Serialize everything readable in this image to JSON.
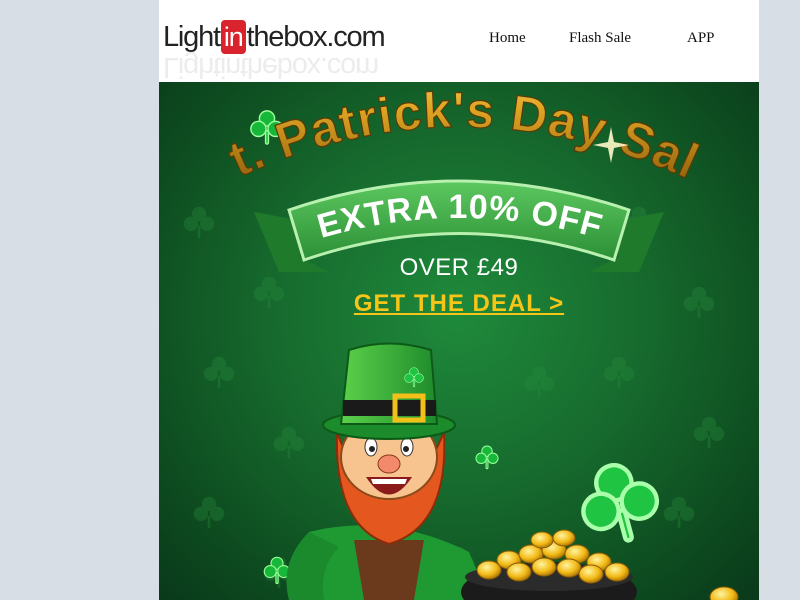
{
  "header": {
    "logo": {
      "part1": "Light",
      "part2": "in",
      "part3": "thebox",
      "part4": ".com"
    },
    "nav": [
      {
        "label": "Home"
      },
      {
        "label": "Flash Sale"
      },
      {
        "label": "APP"
      }
    ]
  },
  "banner": {
    "headline": "St. Patrick's Day Sale",
    "ribbon_text": "EXTRA 10% OFF",
    "threshold": "OVER £49",
    "cta_label": "GET THE DEAL >",
    "colors": {
      "background": "#16692d",
      "headline_gold": "#d9a21b",
      "ribbon_green": "#3fae4a",
      "cta_yellow": "#f5c518",
      "logo_red": "#d9242e"
    },
    "icons": [
      "shamrock-icon",
      "leprechaun-illustration",
      "gold-pot-illustration"
    ]
  }
}
